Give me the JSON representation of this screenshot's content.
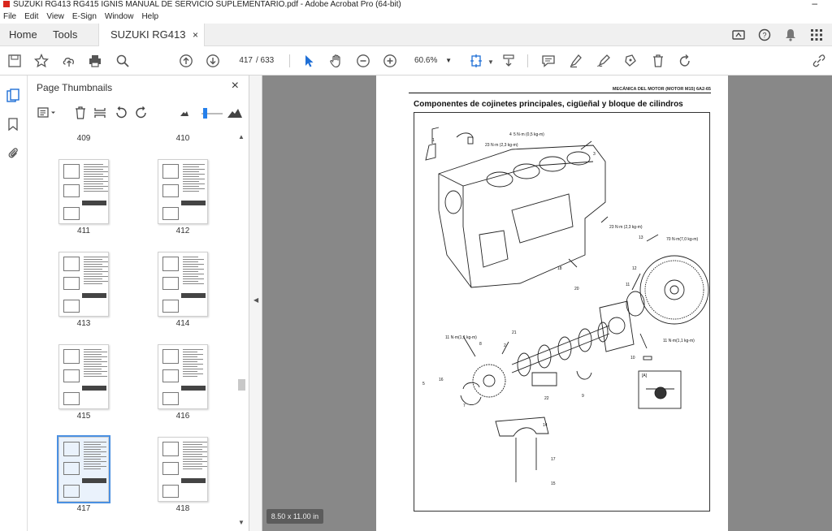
{
  "window": {
    "title": "SUZUKI RG413 RG415 IGNIS MANUAL DE SERVICIO SUPLEMENTARIO.pdf - Adobe Acrobat Pro (64-bit)",
    "minimize_glyph": "–"
  },
  "menu": [
    "File",
    "Edit",
    "View",
    "E-Sign",
    "Window",
    "Help"
  ],
  "tabs": {
    "home": "Home",
    "tools": "Tools",
    "document": "SUZUKI RG413 RG...",
    "close": "×"
  },
  "toolbar": {
    "current_page": "417",
    "total_pages": "/ 633",
    "zoom": "60.6%"
  },
  "panel": {
    "title": "Page Thumbnails",
    "close": "×",
    "thumbnails": [
      {
        "page": "409",
        "col": 0,
        "row": -1
      },
      {
        "page": "410",
        "col": 1,
        "row": -1
      },
      {
        "page": "411",
        "col": 0,
        "row": 0
      },
      {
        "page": "412",
        "col": 1,
        "row": 0
      },
      {
        "page": "413",
        "col": 0,
        "row": 1
      },
      {
        "page": "414",
        "col": 1,
        "row": 1
      },
      {
        "page": "415",
        "col": 0,
        "row": 2
      },
      {
        "page": "416",
        "col": 1,
        "row": 2
      },
      {
        "page": "417",
        "col": 0,
        "row": 3,
        "selected": true
      },
      {
        "page": "418",
        "col": 1,
        "row": 3
      }
    ]
  },
  "document": {
    "header": "MECÁNICA DEL MOTOR (MOTOR M15) 6A2-65",
    "heading": "Componentes de cojinetes principales, cigüeñal y bloque de cilindros",
    "page_size": "8.50 x 11.00 in",
    "callouts": {
      "c1": "1",
      "c2": "23 N·m (2,3 kg-m)",
      "c3": "3",
      "c4": "5 N·m (0,5 kg-m)",
      "c5": "23 N·m (2,3 kg-m)",
      "c6": "70 N·m(7,0 kg-m)",
      "c7": "13",
      "c8": "12",
      "c9": "18",
      "c10": "20",
      "c11": "11",
      "c12": "11 N·m(1,1 kg-m)",
      "c13": "11 N·m(1,1 kg-m)",
      "c14": "10",
      "c15": "[A]",
      "c16": "22",
      "c17": "8",
      "c18": "9",
      "c19": "14",
      "c20": "17",
      "c21": "15",
      "c22": "16",
      "c23": "7",
      "c24": "21",
      "c25": "2",
      "c26": "4",
      "c27": "5"
    }
  }
}
